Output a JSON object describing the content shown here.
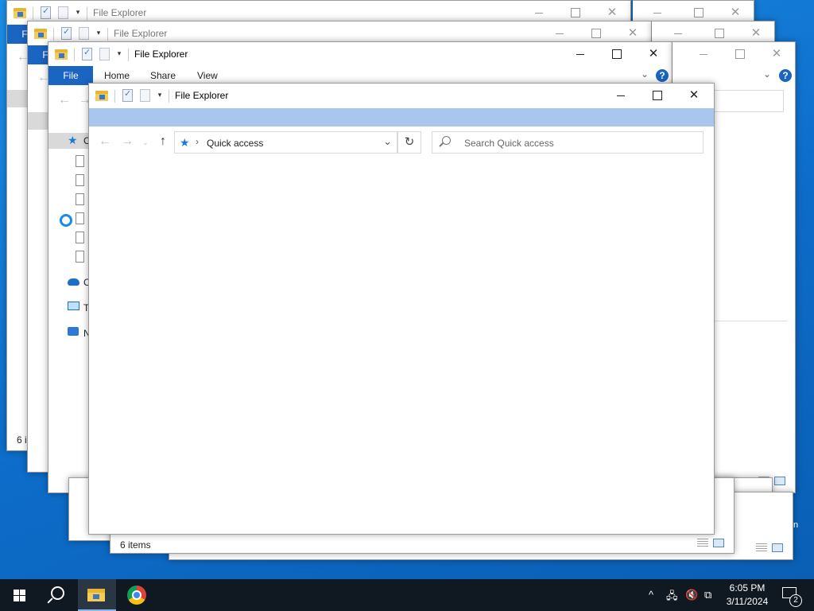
{
  "window_title": "File Explorer",
  "ribbon": {
    "file": "File",
    "home": "Home",
    "share": "Share",
    "view": "View",
    "help": "?"
  },
  "caption": {
    "minimize": "",
    "maximize": "",
    "close": "✕"
  },
  "nav": {
    "back": "←",
    "forward": "→",
    "recent": "⌄",
    "up": "↑",
    "breadcrumb_sep": "›",
    "location": "Quick access",
    "dropdown": "⌄",
    "refresh": "↻",
    "search_placeholder": "Search Quick access"
  },
  "status": {
    "item_count": "6 items",
    "item_count_partial": "6 i"
  },
  "sidebar_letters": {
    "quick_access": "C",
    "onedrive": "C",
    "this_pc": "T",
    "network": "N"
  },
  "tray": {
    "chevron": "^",
    "time": "6:05 PM",
    "date": "3/11/2024",
    "notification_count": "2",
    "edge_text": "n"
  },
  "colors": {
    "accent": "#1a64c2",
    "highlight": "#a9c6ee",
    "taskbar": "#101822"
  },
  "icons": [
    "folder-icon",
    "properties-icon",
    "new-folder-icon",
    "customize-dropdown-icon",
    "star-icon",
    "search-icon",
    "refresh-icon",
    "windows-logo-icon",
    "chrome-icon",
    "network-icon",
    "volume-muted-icon"
  ]
}
